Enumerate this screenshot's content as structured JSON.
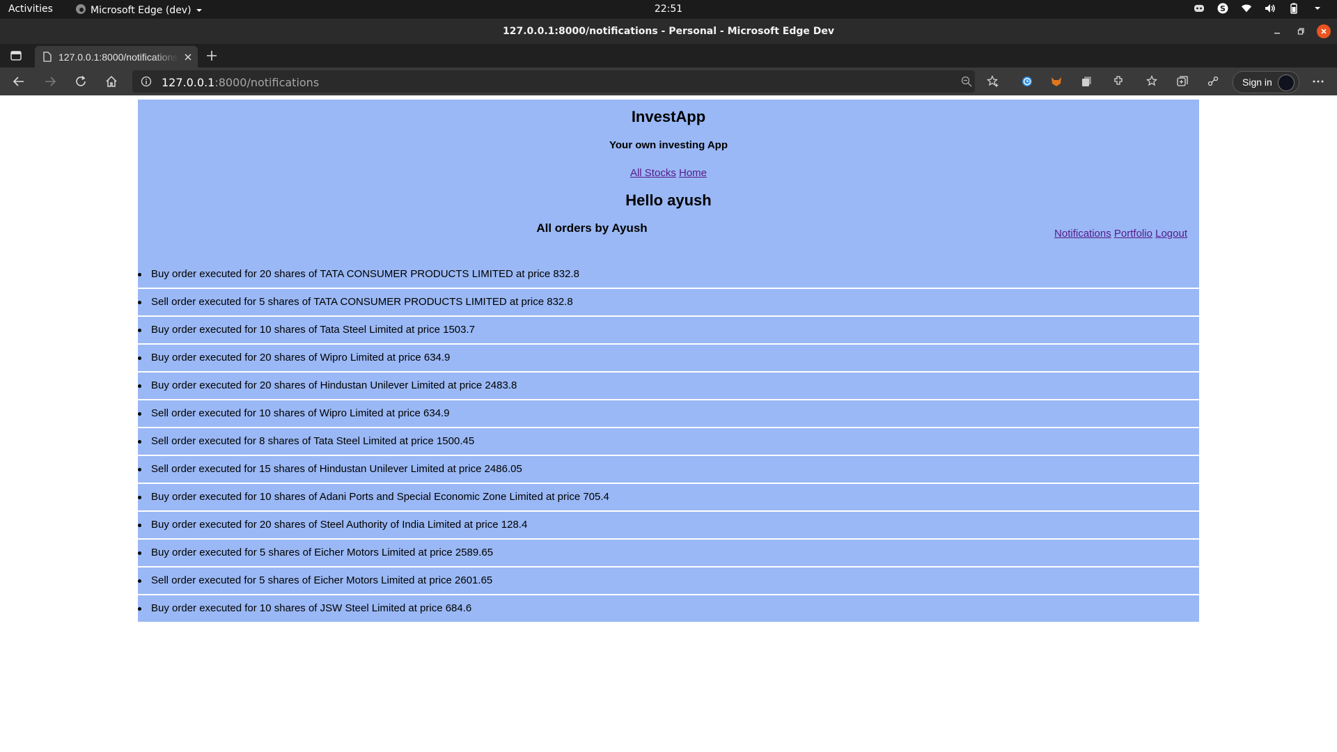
{
  "system_bar": {
    "activities": "Activities",
    "app_name": "Microsoft Edge (dev)",
    "clock": "22:51"
  },
  "window": {
    "title": "127.0.0.1:8000/notifications - Personal - Microsoft Edge Dev"
  },
  "tab": {
    "title": "127.0.0.1:8000/notifications"
  },
  "address_bar": {
    "host": "127.0.0.1",
    "rest": ":8000/notifications"
  },
  "toolbar": {
    "sign_in_label": "Sign in"
  },
  "page": {
    "app_title": "InvestApp",
    "tagline": "Your own investing App",
    "nav": {
      "all_stocks": "All Stocks",
      "home": "Home"
    },
    "greeting": "Hello ayush",
    "orders_heading": "All orders by Ayush",
    "user_links": {
      "notifications": "Notifications",
      "portfolio": "Portfolio",
      "logout": "Logout"
    },
    "orders": [
      "Buy order executed for 20 shares of TATA CONSUMER PRODUCTS LIMITED at price 832.8",
      "Sell order executed for 5 shares of TATA CONSUMER PRODUCTS LIMITED at price 832.8",
      "Buy order executed for 10 shares of Tata Steel Limited at price 1503.7",
      "Buy order executed for 20 shares of Wipro Limited at price 634.9",
      "Buy order executed for 20 shares of Hindustan Unilever Limited at price 2483.8",
      "Sell order executed for 10 shares of Wipro Limited at price 634.9",
      "Sell order executed for 8 shares of Tata Steel Limited at price 1500.45",
      "Sell order executed for 15 shares of Hindustan Unilever Limited at price 2486.05",
      "Buy order executed for 10 shares of Adani Ports and Special Economic Zone Limited at price 705.4",
      "Buy order executed for 20 shares of Steel Authority of India Limited at price 128.4",
      "Buy order executed for 5 shares of Eicher Motors Limited at price 2589.65",
      "Sell order executed for 5 shares of Eicher Motors Limited at price 2601.65",
      "Buy order executed for 10 shares of JSW Steel Limited at price 684.6"
    ]
  },
  "colors": {
    "content_background": "#9ab8f5",
    "link": "#551a8b",
    "browser_chrome": "#3a3a3a",
    "close_button": "#e95420"
  },
  "icons": {
    "system": [
      "discord-icon",
      "skype-icon",
      "wifi-icon",
      "volume-icon",
      "battery-icon",
      "chevron-down-icon"
    ],
    "window_controls": [
      "minimize-icon",
      "maximize-icon",
      "close-icon"
    ],
    "browser": [
      "sidebar-icon",
      "page-icon",
      "tab-close-icon",
      "new-tab-icon",
      "back-icon",
      "forward-icon",
      "refresh-icon",
      "home-icon",
      "info-icon",
      "zoom-icon",
      "add-favorite-icon",
      "extension-clock-icon",
      "extension-fox-icon",
      "extension-copy-icon",
      "extensions-icon",
      "favorites-icon",
      "collections-icon",
      "share-icon",
      "more-icon"
    ]
  }
}
